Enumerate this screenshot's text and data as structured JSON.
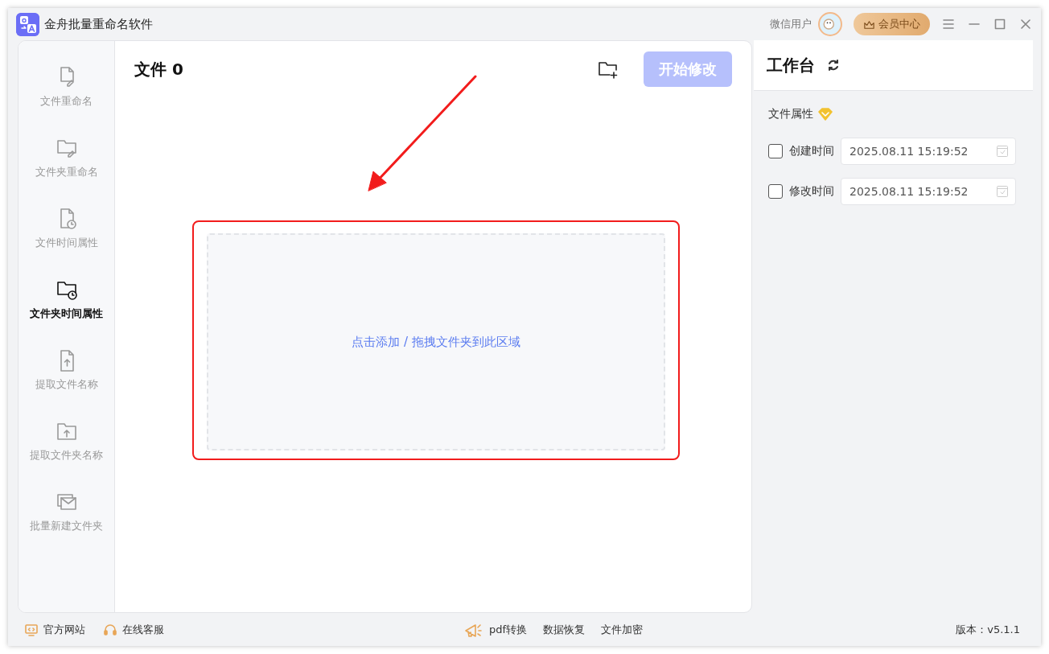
{
  "window": {
    "title": "金舟批量重命名软件",
    "user": "微信用户",
    "vip_button": "会员中心"
  },
  "sidebar": {
    "items": [
      {
        "label": "文件重命名",
        "selected": false
      },
      {
        "label": "文件夹重命名",
        "selected": false
      },
      {
        "label": "文件时间属性",
        "selected": false
      },
      {
        "label": "文件夹时间属性",
        "selected": true
      },
      {
        "label": "提取文件名称",
        "selected": false
      },
      {
        "label": "提取文件夹名称",
        "selected": false
      },
      {
        "label": "批量新建文件夹",
        "selected": false
      }
    ]
  },
  "main": {
    "title": "文件 0",
    "start_button": {
      "label": "开始修改",
      "disabled": true
    },
    "drop_zone": "点击添加 / 拖拽文件夹到此区域"
  },
  "workbench": {
    "title": "工作台",
    "section": "文件属性",
    "fields": [
      {
        "label": "创建时间",
        "checked": false,
        "value": "2025.08.11 15:19:52"
      },
      {
        "label": "修改时间",
        "checked": false,
        "value": "2025.08.11 15:19:52"
      }
    ]
  },
  "footer": {
    "left": [
      "官方网站",
      "在线客服"
    ],
    "center": [
      "pdf转换",
      "数据恢复",
      "文件加密"
    ],
    "version": "版本：v5.1.1"
  }
}
